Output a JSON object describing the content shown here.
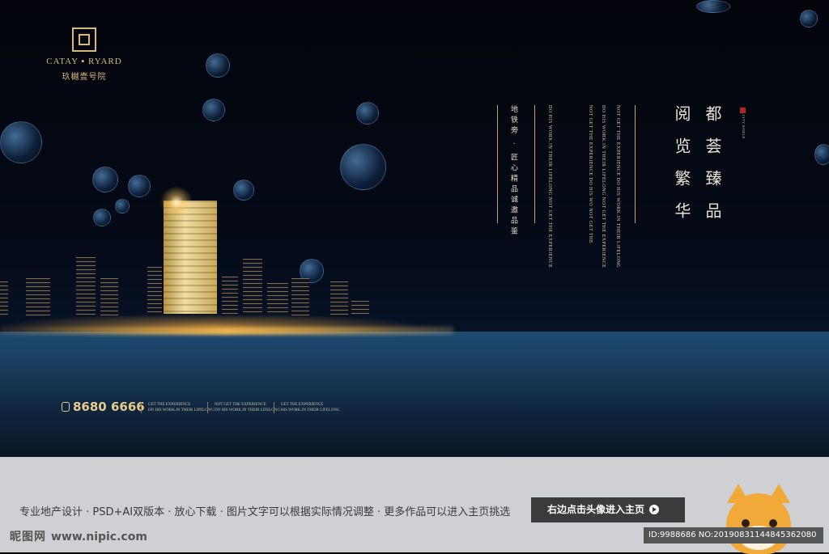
{
  "brand": {
    "name_en": "CATAY ▪ RYARD",
    "name_cn": "玖樾壹号院"
  },
  "headline": {
    "col1": "都荟臻品",
    "col2": "阅览繁华",
    "side_mark": "CITY WORLD"
  },
  "subtitle": {
    "col1": "地铁旁 · 匠心精品诚邀品鉴"
  },
  "english_lines": [
    "NOT GET THE EXPERIENCE DO HIS WORK.IN THEIR LIFELONG",
    "DO HIS WORK.IN THEIR LIFELONG NOT GET THE EXPERIENCE",
    "NOT GET THE EXPERIENCE DO HIS WO NOT GET THE",
    "DO HIS WORK.IN THEIR LIFELONG NOT GET THE EXPERIENCE"
  ],
  "contact": {
    "phone": "8680 6666"
  },
  "bottom_en": [
    {
      "line1": "GET THE EXPERIENCE",
      "line2": "DO HIS WORK.IN THEIR LIFELONG"
    },
    {
      "line1": "NOT GET THE EXPERIENCE",
      "line2": "DO HIS WORK.IN THEIR LIFELONG"
    },
    {
      "line1": "GET THE EXPERIENCE",
      "line2": "HIS WORK.IN THEIR LIFELONG"
    }
  ],
  "footer": {
    "description": "专业地产设计 · PSD+AI双版本 · 放心下载 · 图片文字可以根据实际情况调整 · 更多作品可以进入主页挑选",
    "cta": "右边点击头像进入主页",
    "watermark_brand": "昵图网",
    "watermark_url": "www.nipic.com",
    "id_line": "ID:9988686 NO:20190831144845362080"
  },
  "colors": {
    "gold": "#d8b97a",
    "sea": "#1f4a72",
    "footer_bg": "#cfd0d3",
    "cta_bg": "#3b3b3d"
  }
}
